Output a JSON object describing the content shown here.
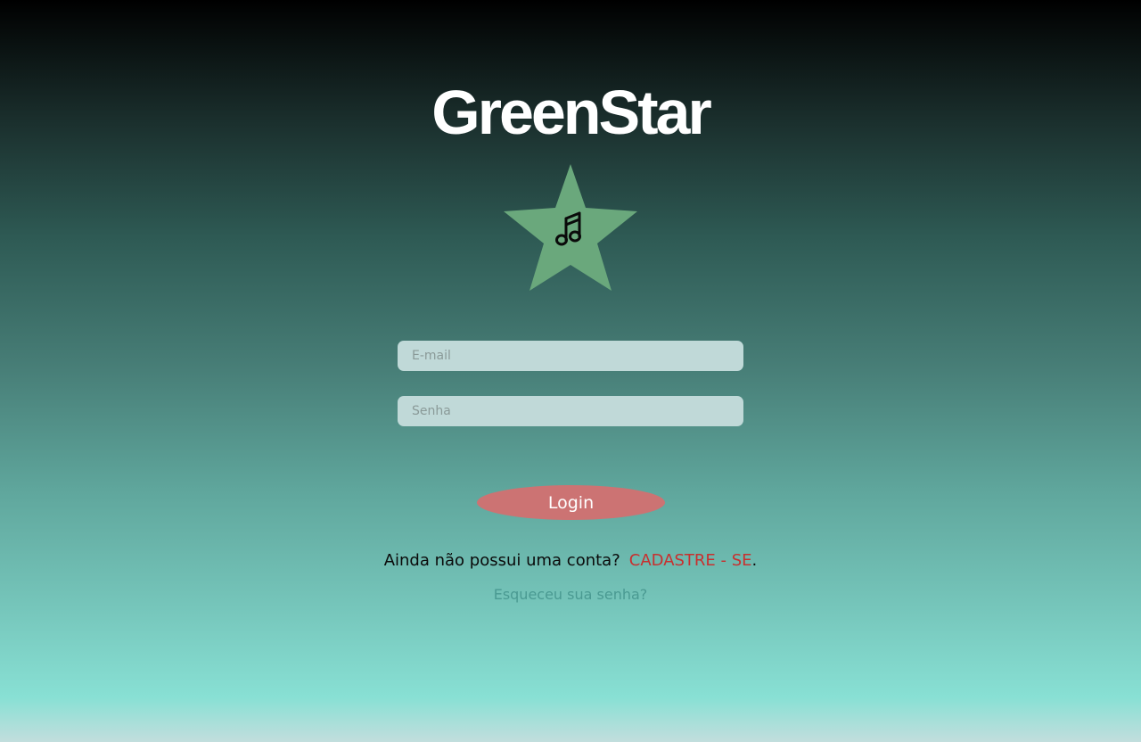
{
  "brand": {
    "title": "GreenStar",
    "logo_icon": "music-note-icon",
    "star_color": "#6aa87c"
  },
  "form": {
    "email": {
      "placeholder": "E-mail",
      "value": ""
    },
    "password": {
      "placeholder": "Senha",
      "value": ""
    },
    "login_label": "Login"
  },
  "signup": {
    "prompt": "Ainda não possui uma conta?",
    "link_label": "CADASTRE - SE",
    "suffix": "."
  },
  "forgot": {
    "label": "Esqueceu sua senha?"
  },
  "colors": {
    "accent": "#cc7373",
    "link": "#c8302f",
    "muted_link": "#4a9a92",
    "input_bg": "#c0d9d8"
  }
}
